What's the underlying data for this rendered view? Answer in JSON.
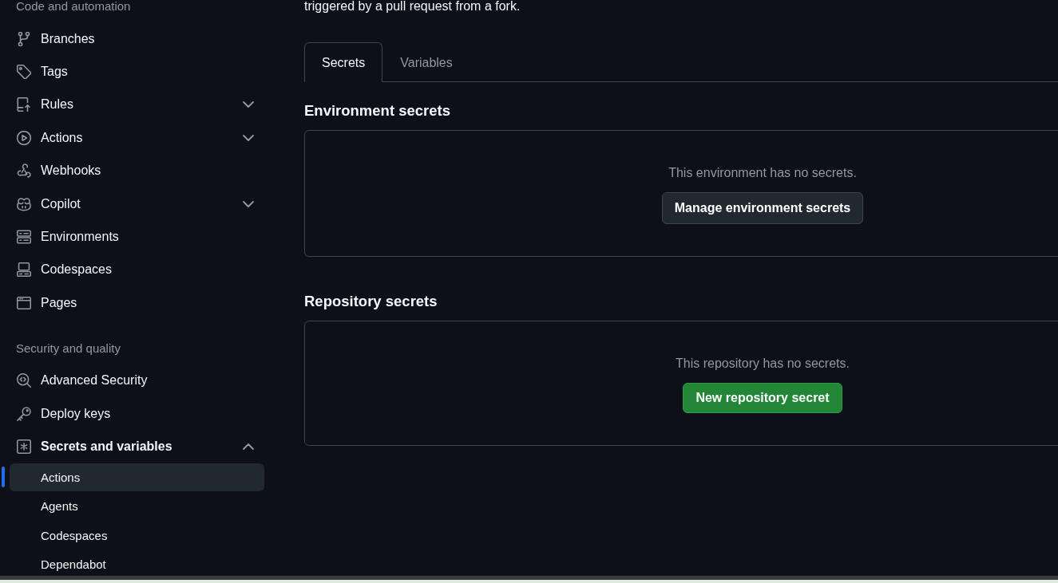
{
  "sidebar": {
    "sections": [
      {
        "heading": "Code and automation",
        "items": [
          {
            "label": "Branches",
            "kind": "link"
          },
          {
            "label": "Tags",
            "kind": "link"
          },
          {
            "label": "Rules",
            "kind": "group",
            "expanded": false
          },
          {
            "label": "Actions",
            "kind": "group",
            "expanded": false
          },
          {
            "label": "Webhooks",
            "kind": "link"
          },
          {
            "label": "Copilot",
            "kind": "group",
            "expanded": false
          },
          {
            "label": "Environments",
            "kind": "link"
          },
          {
            "label": "Codespaces",
            "kind": "link"
          },
          {
            "label": "Pages",
            "kind": "link"
          }
        ]
      },
      {
        "heading": "Security and quality",
        "items": [
          {
            "label": "Advanced Security",
            "kind": "link"
          },
          {
            "label": "Deploy keys",
            "kind": "link"
          },
          {
            "label": "Secrets and variables",
            "kind": "group",
            "expanded": true,
            "children": [
              {
                "label": "Actions",
                "selected": true
              },
              {
                "label": "Agents",
                "selected": false
              },
              {
                "label": "Codespaces",
                "selected": false
              },
              {
                "label": "Dependabot",
                "selected": false
              }
            ]
          }
        ]
      }
    ]
  },
  "description": "triggered by a pull request from a fork.",
  "tabs": [
    {
      "label": "Secrets",
      "selected": true
    },
    {
      "label": "Variables",
      "selected": false
    }
  ],
  "secret_groups": [
    {
      "heading": "Environment secrets",
      "empty_message": "This environment has no secrets.",
      "button": {
        "label": "Manage environment secrets",
        "kind": "secondary"
      }
    },
    {
      "heading": "Repository secrets",
      "empty_message": "This repository has no secrets.",
      "button": {
        "label": "New repository secret",
        "kind": "primary"
      }
    }
  ]
}
